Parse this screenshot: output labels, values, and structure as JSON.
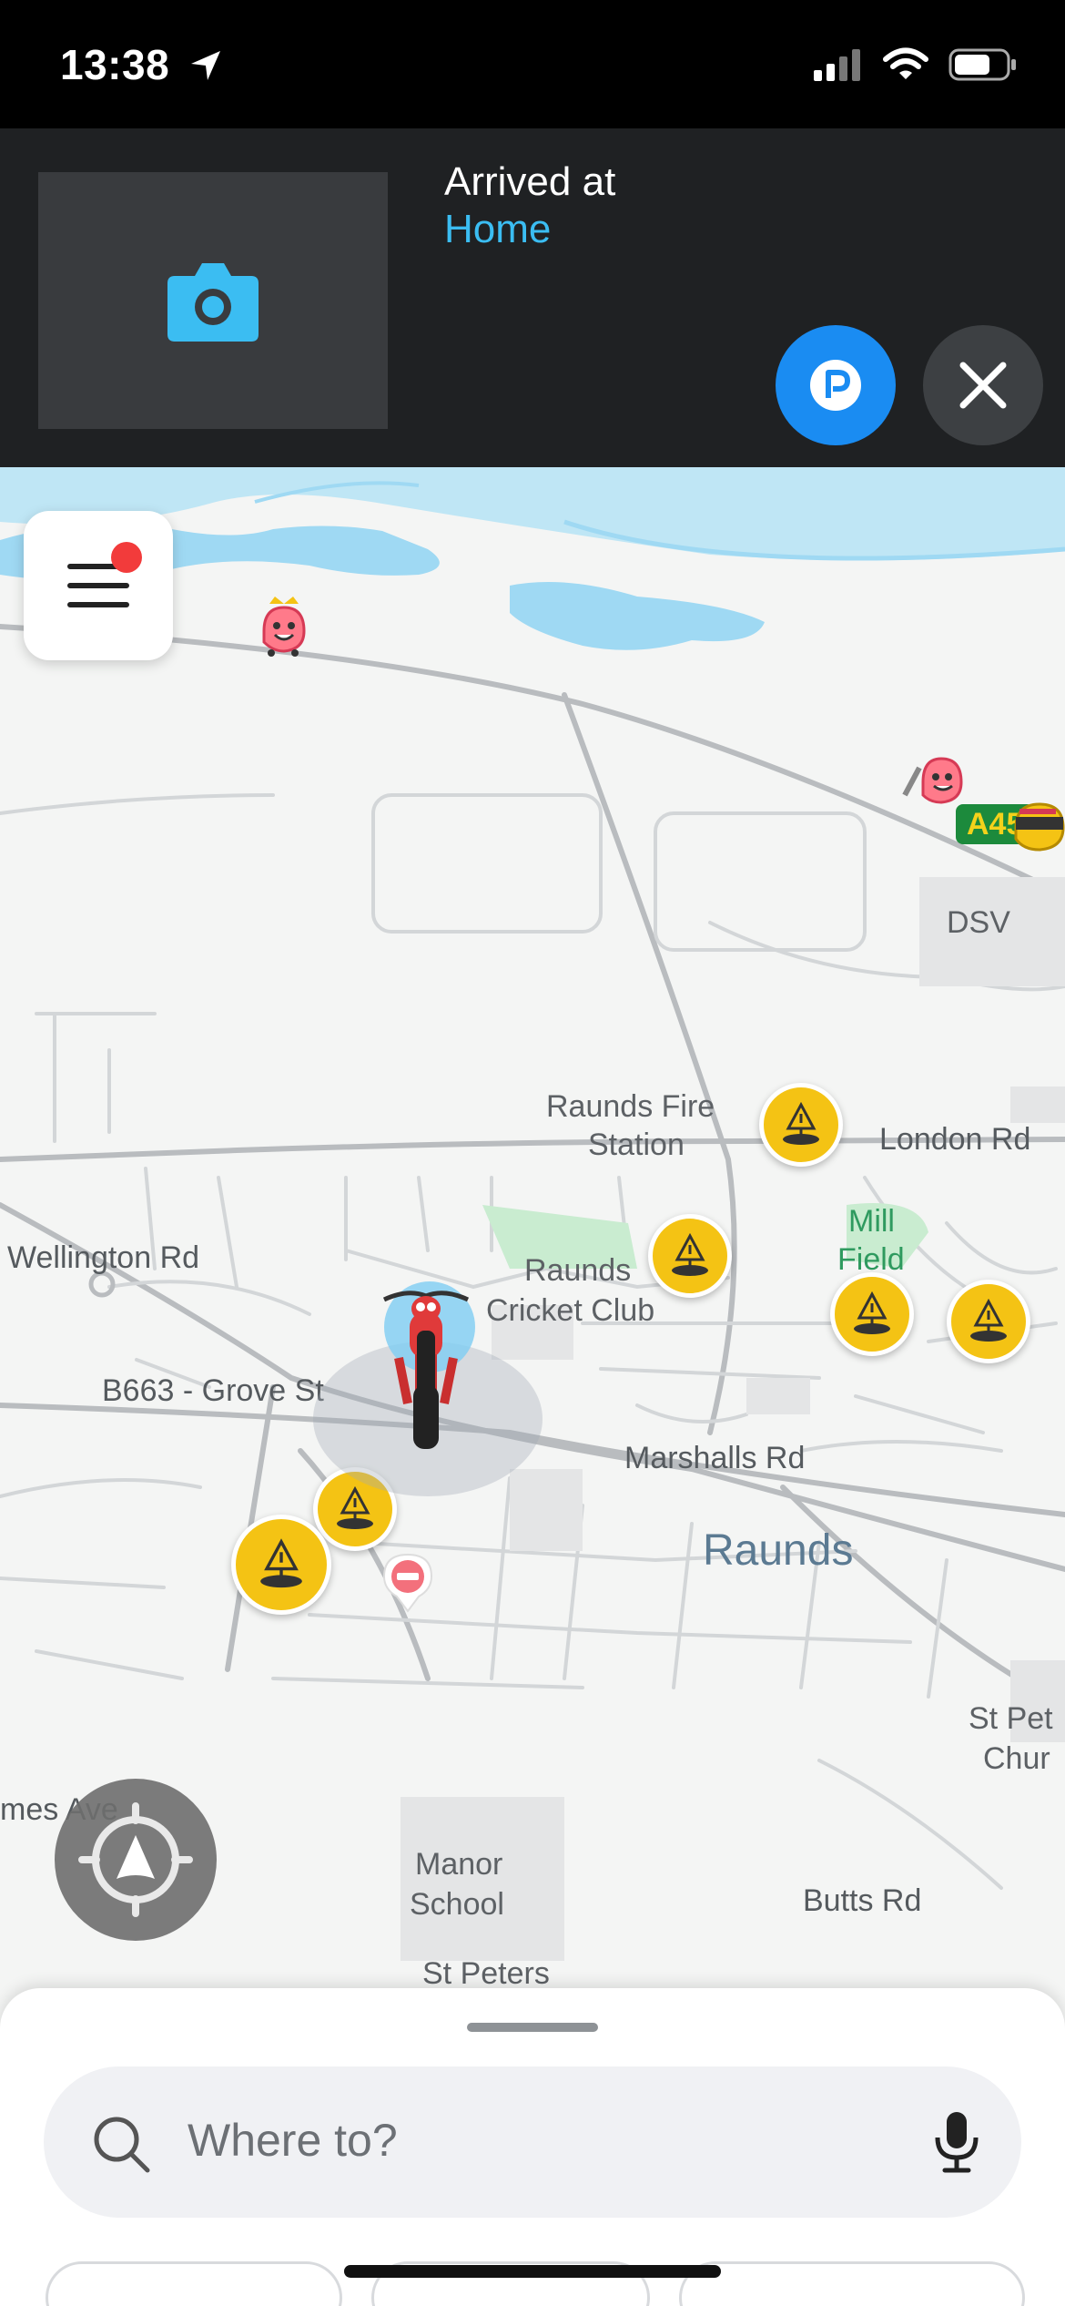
{
  "status_bar": {
    "time": "13:38"
  },
  "banner": {
    "arrived_label": "Arrived at",
    "place": "Home"
  },
  "map": {
    "labels": {
      "dsv": "DSV",
      "road_a45": "A45",
      "fire_station_1": "Raunds Fire",
      "fire_station_2": "Station",
      "london_rd": "London Rd",
      "mill_field_1": "Mill",
      "mill_field_2": "Field",
      "wellington_rd": "Wellington Rd",
      "cricket_1": "Raunds",
      "cricket_2": "Cricket Club",
      "grove_st": "B663 - Grove St",
      "marshalls_rd": "Marshalls Rd",
      "town": "Raunds",
      "st_peters_church_1": "St Pet",
      "st_peters_church_2": "Chur",
      "james_ave": "mes Ave",
      "manor_school_1": "Manor",
      "manor_school_2": "School",
      "butts_rd": "Butts Rd",
      "st_peters": "St Peters"
    }
  },
  "search": {
    "placeholder": "Where to?"
  },
  "colors": {
    "accent_blue": "#1a8cf2",
    "hazard_yellow": "#f4c314",
    "banner_bg": "#1f2123"
  }
}
